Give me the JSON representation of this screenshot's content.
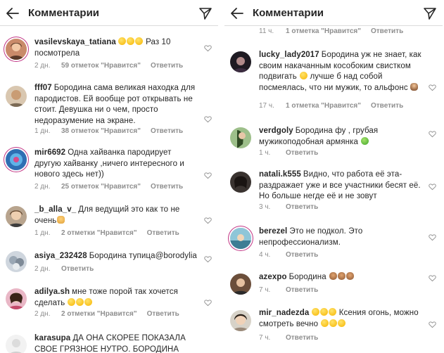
{
  "left_panel": {
    "header": {
      "title": "Комментарии",
      "back_icon": "arrow-left-icon",
      "share_icon": "paper-plane-icon"
    },
    "comments": [
      {
        "username": "vasilevskaya_tatiana",
        "text_before": "",
        "emojis": [
          "smile",
          "smile",
          "smile"
        ],
        "text_after": "Раз 10 посмотрела",
        "time": "2 дн.",
        "likes": "59 отметок \"Нравится\"",
        "reply": "Ответить"
      },
      {
        "username": "fff07",
        "text_before": "Бородина сама великая находка для пародистов. Ей вообще рот открывать не стоит.  Девушка ни о чем, просто недоразумение на экране.",
        "emojis": [],
        "text_after": "",
        "time": "1 дн.",
        "likes": "38 отметок \"Нравится\"",
        "reply": "Ответить"
      },
      {
        "username": "mir6692",
        "text_before": "Одна хайванка пародирует другую хайванку ,ничего интересного и нового здесь нет))",
        "emojis": [],
        "text_after": "",
        "time": "2 дн.",
        "likes": "25 отметок \"Нравится\"",
        "reply": "Ответить"
      },
      {
        "username": "_b_alla_v_",
        "text_before": "Для ведущий это как то не очень",
        "emojis": [
          "fist"
        ],
        "text_after": "",
        "time": "1 дн.",
        "likes": "2 отметки \"Нравится\"",
        "reply": "Ответить"
      },
      {
        "username": "asiya_232428",
        "text_before": "Бородина тупица@borodylia",
        "emojis": [],
        "text_after": "",
        "time": "2 дн.",
        "likes": "",
        "reply": "Ответить"
      },
      {
        "username": "adilya.sh",
        "text_before": "мне тоже порой так хочется сделать",
        "emojis": [
          "smile",
          "smile",
          "smile"
        ],
        "text_after": "",
        "time": "2 дн.",
        "likes": "2 отметки \"Нравится\"",
        "reply": "Ответить"
      },
      {
        "username": "karasupa",
        "text_before": "ДА ОНА СКОРЕЕ ПОКАЗАЛА СВОЕ ГРЯЗНОЕ НУТРО. БОРОДИНА",
        "emojis": [],
        "text_after": "",
        "time": "",
        "likes": "",
        "reply": ""
      }
    ]
  },
  "right_panel": {
    "header": {
      "title": "Комментарии",
      "back_icon": "arrow-left-icon",
      "share_icon": "paper-plane-icon"
    },
    "top_meta": {
      "time": "11 ч.",
      "likes": "1 отметка \"Нравится\"",
      "reply": "Ответить"
    },
    "comments": [
      {
        "username": "lucky_lady2017",
        "text_before": "Бородина уж не знает, как своим накачанным кособоким свистком подвигать",
        "emojis": [
          "smile"
        ],
        "text_after": "лучше б над собой посмеялась, что ни мужик, то альфонс",
        "trailing_emojis": [
          "woman"
        ],
        "time": "17 ч.",
        "likes": "1 отметка \"Нравится\"",
        "reply": "Ответить"
      },
      {
        "username": "verdgoly",
        "text_before": "Бородина фу , грубая мужикоподобная армянка",
        "emojis": [
          "green"
        ],
        "text_after": "",
        "time": "1 ч.",
        "likes": "",
        "reply": "Ответить"
      },
      {
        "username": "natali.k555",
        "text_before": "Видно, что работа её эта- раздражает уже и все участники бесят её. Но больше негде её и не зовут",
        "emojis": [],
        "text_after": "",
        "time": "3 ч.",
        "likes": "",
        "reply": "Ответить"
      },
      {
        "username": "berezel",
        "text_before": "Это не подкол. Это непрофессионализм.",
        "emojis": [],
        "text_after": "",
        "time": "4 ч.",
        "likes": "",
        "reply": "Ответить"
      },
      {
        "username": "azexpo",
        "text_before": "Бородина",
        "emojis": [
          "monkey",
          "monkey",
          "monkey"
        ],
        "text_after": "",
        "time": "7 ч.",
        "likes": "",
        "reply": "Ответить"
      },
      {
        "username": "mir_nadezda",
        "text_before": "",
        "emojis": [
          "smile",
          "smile",
          "smile"
        ],
        "text_after": "Ксения огонь, можно смотреть вечно",
        "trailing_emojis": [
          "smile",
          "smile",
          "smile"
        ],
        "time": "7 ч.",
        "likes": "",
        "reply": "Ответить"
      }
    ]
  },
  "icons": {
    "heart": "heart-outline-icon"
  },
  "colors": {
    "text": "#262626",
    "meta": "#8e8e8e",
    "story_ring": "#c13584",
    "divider": "#dbdbdb"
  }
}
